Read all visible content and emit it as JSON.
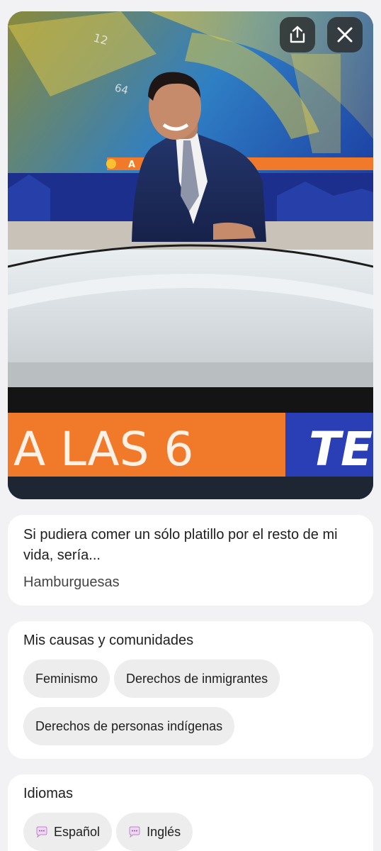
{
  "photo": {
    "ticker_text": "A LAS 6",
    "ticker_text_2": "TE",
    "lower_third_letter": "A",
    "backdrop_numbers": [
      "12",
      "64"
    ],
    "share_icon": "share-icon",
    "close_icon": "close-icon"
  },
  "prompt": {
    "question": "Si pudiera comer un sólo platillo por el resto de mi vida, sería...",
    "answer": "Hamburguesas"
  },
  "causes": {
    "title": "Mis causas y comunidades",
    "items": [
      "Feminismo",
      "Derechos de inmigrantes",
      "Derechos de personas indígenas"
    ]
  },
  "languages": {
    "title": "Idiomas",
    "items": [
      "Español",
      "Inglés"
    ],
    "icon": "speech-bubble-icon"
  },
  "colors": {
    "ticker_orange": "#f07a2a",
    "ticker_blue": "#2a3fb5",
    "card_bg": "#ffffff",
    "chip_bg": "#ededed"
  }
}
